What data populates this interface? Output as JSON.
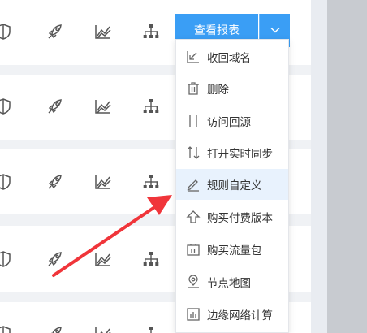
{
  "report_button": {
    "label": "查看报表"
  },
  "menu": {
    "items": [
      {
        "label": "收回域名",
        "icon": "reclaim-domain-icon"
      },
      {
        "label": "删除",
        "icon": "trash-icon"
      },
      {
        "label": "访问回源",
        "icon": "origin-access-icon"
      },
      {
        "label": "打开实时同步",
        "icon": "sync-icon"
      },
      {
        "label": "规则自定义",
        "icon": "pencil-icon",
        "highlighted": true
      },
      {
        "label": "购买付费版本",
        "icon": "upgrade-arrow-icon"
      },
      {
        "label": "购买流量包",
        "icon": "traffic-package-icon"
      },
      {
        "label": "节点地图",
        "icon": "map-pin-icon"
      },
      {
        "label": "边缘网络计算",
        "icon": "bar-chart-icon"
      }
    ]
  },
  "row_icons": [
    "shield-icon",
    "rocket-icon",
    "line-chart-icon",
    "org-tree-icon"
  ],
  "colors": {
    "accent": "#3a9ef5",
    "menu_highlight": "#e8f2fd",
    "annotation_arrow": "#f0353a"
  }
}
